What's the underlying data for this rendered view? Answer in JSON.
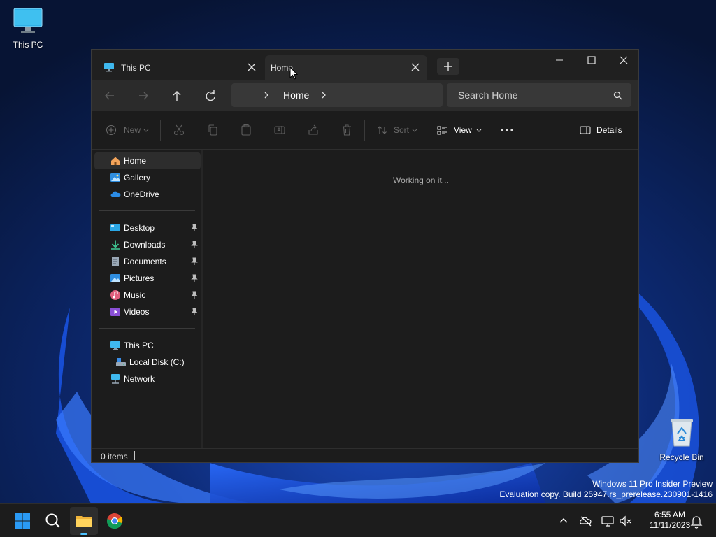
{
  "desktop": {
    "icons": [
      {
        "label": "This PC",
        "icon": "monitor-icon"
      },
      {
        "label": "Recycle Bin",
        "icon": "recycle-bin-icon"
      }
    ],
    "watermark": {
      "line1": "Windows 11 Pro Insider Preview",
      "line2": "Evaluation copy. Build 25947.rs_prerelease.230901-1416"
    }
  },
  "window": {
    "tabs": [
      {
        "label": "This PC",
        "active": false,
        "icon": "monitor-icon"
      },
      {
        "label": "Home",
        "active": true,
        "icon": "home-icon"
      }
    ],
    "controls": [
      "minimize-icon",
      "maximize-icon",
      "close-icon"
    ],
    "address": {
      "segments": [
        "Home"
      ]
    },
    "search": {
      "placeholder": "Search Home"
    },
    "commands": {
      "new": "New",
      "sort": "Sort",
      "view": "View",
      "details": "Details"
    },
    "sidebar": {
      "top": [
        {
          "label": "Home",
          "icon": "home-icon",
          "selected": true
        },
        {
          "label": "Gallery",
          "icon": "gallery-icon"
        },
        {
          "label": "OneDrive",
          "icon": "onedrive-icon"
        }
      ],
      "pinned": [
        {
          "label": "Desktop",
          "icon": "desktop-folder-icon"
        },
        {
          "label": "Downloads",
          "icon": "downloads-icon"
        },
        {
          "label": "Documents",
          "icon": "documents-icon"
        },
        {
          "label": "Pictures",
          "icon": "pictures-icon"
        },
        {
          "label": "Music",
          "icon": "music-icon"
        },
        {
          "label": "Videos",
          "icon": "videos-icon"
        }
      ],
      "devices": [
        {
          "label": "This PC",
          "icon": "monitor-icon"
        },
        {
          "label": "Local Disk (C:)",
          "icon": "drive-icon"
        },
        {
          "label": "Network",
          "icon": "network-icon"
        }
      ]
    },
    "content": {
      "message": "Working on it..."
    },
    "status": {
      "items": "0 items"
    }
  },
  "taskbar": {
    "apps": [
      "start-icon",
      "search-icon",
      "file-explorer-icon",
      "chrome-icon"
    ],
    "clock": {
      "time": "6:55 AM",
      "date": "11/11/2023"
    },
    "tray": [
      "chevron-up-icon",
      "onedrive-off-icon",
      "display-icon",
      "speaker-muted-icon",
      "notification-bell-icon"
    ]
  },
  "colors": {
    "accent": "#0078d4",
    "window_bg": "#1c1c1c",
    "titlebar_bg": "#202020",
    "taskbar_bg": "#1c1c1c"
  }
}
